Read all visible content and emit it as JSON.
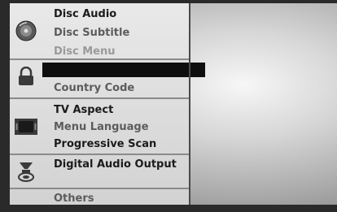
{
  "menu": {
    "groups": [
      {
        "icon": "disc-icon",
        "items": [
          "Disc Audio",
          "Disc Subtitle",
          "Disc Menu"
        ]
      },
      {
        "icon": "lock-icon",
        "items": [
          "",
          "Country Code"
        ]
      },
      {
        "icon": "tv-aspect-icon",
        "items": [
          "TV Aspect",
          "Menu Language",
          "Progressive Scan"
        ]
      },
      {
        "icon": "speaker-icon",
        "items": [
          "Digital Audio Output"
        ]
      },
      {
        "icon": "",
        "items": [
          "Others"
        ]
      }
    ]
  }
}
